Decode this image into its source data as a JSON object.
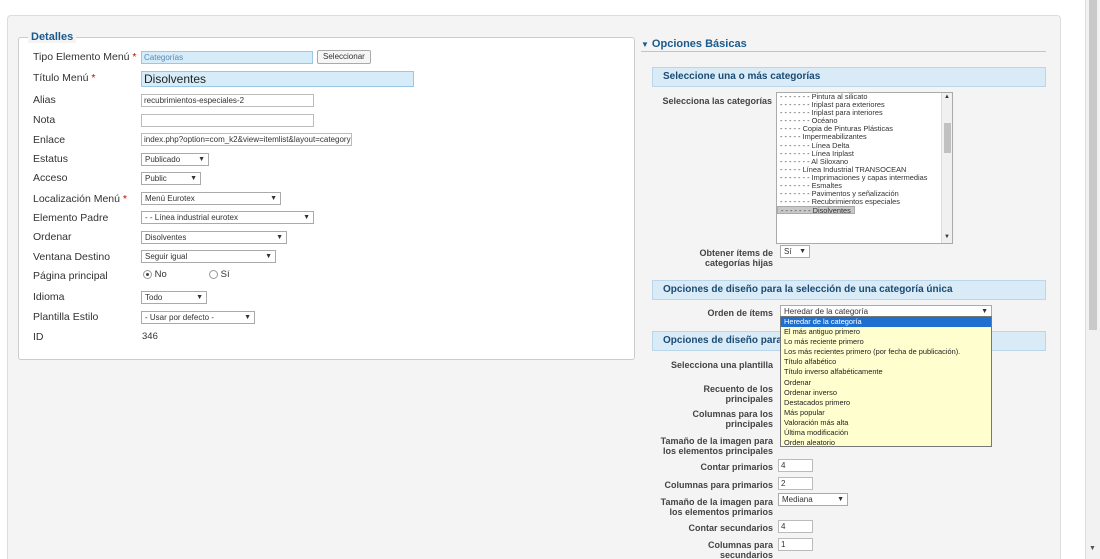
{
  "detalles": {
    "legend": "Detalles",
    "fields": {
      "tipo": {
        "label": "Tipo Elemento Menú",
        "value": "Categorías",
        "button": "Seleccionar"
      },
      "titulo": {
        "label": "Título Menú",
        "value": "Disolventes"
      },
      "alias": {
        "label": "Alias",
        "value": "recubrimientos-especiales-2"
      },
      "nota": {
        "label": "Nota",
        "value": ""
      },
      "enlace": {
        "label": "Enlace",
        "value": "index.php?option=com_k2&view=itemlist&layout=category&"
      },
      "estatus": {
        "label": "Estatus",
        "value": "Publicado"
      },
      "acceso": {
        "label": "Acceso",
        "value": "Public"
      },
      "localizacion": {
        "label": "Localización Menú",
        "value": "Menú Eurotex"
      },
      "padre": {
        "label": "Elemento Padre",
        "value": "- - Línea industrial eurotex"
      },
      "ordenar": {
        "label": "Ordenar",
        "value": "Disolventes"
      },
      "ventana": {
        "label": "Ventana Destino",
        "value": "Seguir igual"
      },
      "principal": {
        "label": "Página principal",
        "no": "No",
        "si": "Sí"
      },
      "idioma": {
        "label": "Idioma",
        "value": "Todo"
      },
      "plantilla": {
        "label": "Plantilla Estilo",
        "value": "- Usar por defecto -"
      },
      "id": {
        "label": "ID",
        "value": "346"
      }
    },
    "required_mark": "*"
  },
  "opciones": {
    "title": "Opciones Básicas",
    "collapse_icon": "triangle-down-icon",
    "sec_categorias": "Seleccione una o más categorías",
    "label_categorias": "Selecciona las categorías",
    "categories": [
      "- - - - - - - Pintura al silicato",
      "- - - - - - - Iriplast para exteriores",
      "- - - - - - - Iriplast para interiores",
      "- - - - - - - Océano",
      "- - - - - Copia de Pinturas Plásticas",
      "- - - - - Impermeabilizantes",
      "- - - - - - - Línea Delta",
      "- - - - - - - Línea Iriplast",
      "- - - - - - - Al Siloxano",
      "- - - - - Línea Industrial TRANSOCEAN",
      "- - - - - - - Imprimaciones y capas intermedias",
      "- - - - - - - Esmaltes",
      "- - - - - - - Pavimentos y señalización",
      "- - - - - - - Recubrimientos especiales",
      "- - - - - - - Disolventes"
    ],
    "label_hijas": "Obtener ítems de categorías hijas",
    "hijas_value": "Sí",
    "sec_unica": "Opciones de diseño para la selección de una categoría única",
    "label_orden": "Orden de ítems",
    "orden_value": "Heredar de la categoría",
    "sec_multi": "Opciones de diseño para la",
    "label_plantilla": "Selecciona una plantilla",
    "label_recuento": "Recuento de los principales",
    "label_columnas_p": "Columnas para los principales",
    "label_tam_p": "Tamaño de la imagen para los elementos principales",
    "label_contar_prim": "Contar primarios",
    "contar_prim": "4",
    "label_col_prim": "Columnas para primarios",
    "col_prim": "2",
    "label_tam_prim": "Tamaño de la imagen para los elementos primarios",
    "tam_prim": "Mediana",
    "label_contar_sec": "Contar secundarios",
    "contar_sec": "4",
    "label_col_sec": "Columnas para secundarios",
    "col_sec": "1",
    "dropdown": [
      "Heredar de la categoría",
      "El más antiguo primero",
      "Lo más reciente primero",
      "Los más recientes primero (por fecha de publicación).",
      "Título alfabético",
      "Título inverso alfabéticamente",
      "Ordenar",
      "Ordenar inverso",
      "Destacados primero",
      "Más popular",
      "Valoración más alta",
      "Última modificación",
      "Orden aleatorio"
    ]
  }
}
